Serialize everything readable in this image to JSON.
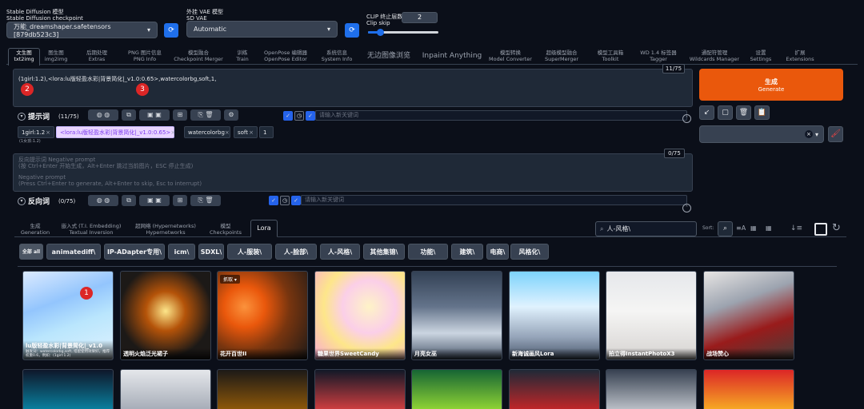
{
  "top": {
    "checkpoint_label": "Stable Diffusion 模型",
    "checkpoint_sublabel": "Stable Diffusion checkpoint",
    "checkpoint_value": "万能_dreamshaper.safetensors [879db523c3]",
    "vae_label": "外挂 VAE 模型",
    "vae_sublabel": "SD VAE",
    "vae_value": "Automatic",
    "clip_label": "CLIP 终止层数",
    "clip_sublabel": "Clip skip",
    "clip_value": "2",
    "clip_slider_fraction": 0.17
  },
  "tabs": [
    {
      "cn": "文生图",
      "en": "txt2img"
    },
    {
      "cn": "图生图",
      "en": "img2img"
    },
    {
      "cn": "后期处理",
      "en": "Extras"
    },
    {
      "cn": "PNG 图片信息",
      "en": "PNG Info"
    },
    {
      "cn": "模型融合",
      "en": "Checkpoint Merger"
    },
    {
      "cn": "训练",
      "en": "Train"
    },
    {
      "cn": "OpenPose 编辑器",
      "en": "OpenPose Editor"
    },
    {
      "cn": "系统信息",
      "en": "System Info"
    },
    {
      "cn": "无边图像浏览",
      "en": ""
    },
    {
      "cn": "Inpaint Anything",
      "en": ""
    },
    {
      "cn": "模型转换",
      "en": "Model Converter"
    },
    {
      "cn": "超级模型融合",
      "en": "SuperMerger"
    },
    {
      "cn": "模型工具箱",
      "en": "Toolkit"
    },
    {
      "cn": "WD 1.4 标签器",
      "en": "Tagger"
    },
    {
      "cn": "通配符管理",
      "en": "Wildcards Manager"
    },
    {
      "cn": "设置",
      "en": "Settings"
    },
    {
      "cn": "扩展",
      "en": "Extensions"
    }
  ],
  "prompt": {
    "text": "(1girl:1.2),<lora:lu版轻盈水彩|背景简化|_v1.0:0.65>,watercolorbg,soft,1,",
    "counter": "11/75",
    "section_label": "提示词",
    "section_count": "(11/75)",
    "keyword_placeholder": "请输入新关键词",
    "badge2": "2",
    "badge3": "3"
  },
  "tags": [
    {
      "text": "1girl:1.2",
      "sub": "(1女孩:1.2)"
    },
    {
      "text": "<lora:lu版轻盈水彩|背景简化|_v1.0:0.65>",
      "sub": ""
    },
    {
      "text": "watercolorbg",
      "sub": ""
    },
    {
      "text": "soft",
      "sub": ""
    },
    {
      "text": "1",
      "sub": ""
    }
  ],
  "negative": {
    "placeholder_cn": "反向提示词 Negative prompt",
    "hint_cn": "(按 Ctrl+Enter 开始生成，Alt+Enter 跳过当前图片，ESC 停止生成)",
    "placeholder_en": "Negative prompt",
    "hint_en": "(Press Ctrl+Enter to generate, Alt+Enter to skip, Esc to interrupt)",
    "counter": "0/75",
    "section_label": "反向词",
    "section_count": "(0/75)",
    "keyword_placeholder": "请输入新关键词"
  },
  "generate": {
    "cn": "生成",
    "en": "Generate"
  },
  "network_tabs": [
    {
      "cn": "生成",
      "en": "Generation"
    },
    {
      "cn": "嵌入式 (T.I. Embedding)",
      "en": "Textual Inversion"
    },
    {
      "cn": "超网络 (Hypernetworks)",
      "en": "Hypernetworks"
    },
    {
      "cn": "模型",
      "en": "Checkpoints"
    },
    {
      "cn": "Lora",
      "en": ""
    }
  ],
  "search_value": "人-风格\\",
  "sort_label": "Sort:",
  "categories": [
    "全部 all",
    "animatediff\\",
    "IP-ADapter专用\\",
    "icm\\",
    "SDXL\\",
    "人-服装\\",
    "人-脸部\\",
    "人-风格\\",
    "其他集锦\\",
    "功能\\",
    "建筑\\",
    "电商\\",
    "风格化\\"
  ],
  "cards": [
    {
      "title": "lu版轻盈水彩|背景简化|_v1.0",
      "desc": "触发词：watercolorbg,soft, 搭配使用效果好，推荐权重0.6，例如：(1girl:1.2)",
      "badge": "1"
    },
    {
      "title": "透明火焰泛光裙子"
    },
    {
      "title": "花开百世II",
      "overlay": "抓取"
    },
    {
      "title": "糖果世界SweetCandy"
    },
    {
      "title": "月亮女巫"
    },
    {
      "title": "新海诚画风Lora"
    },
    {
      "title": "拍立得InstantPhotoX3"
    },
    {
      "title": "战场赞心"
    }
  ],
  "colors": {
    "bg": "#0b0f19",
    "accent": "#ea580c",
    "blue": "#1f6feb"
  }
}
